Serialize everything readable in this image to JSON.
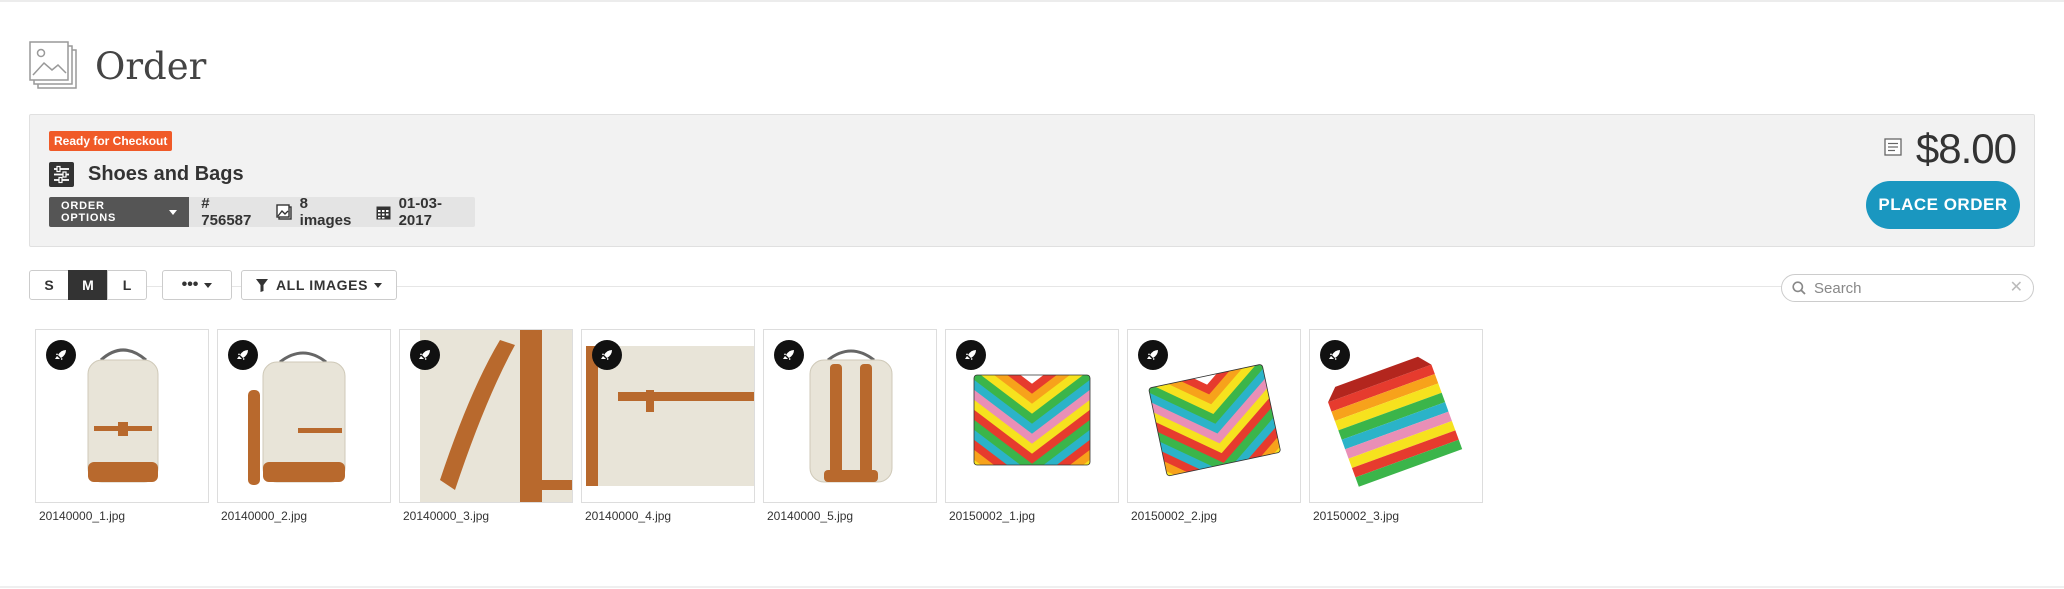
{
  "page": {
    "title": "Order"
  },
  "order": {
    "status": "Ready for Checkout",
    "name": "Shoes and Bags",
    "options_label": "ORDER OPTIONS",
    "number": "# 756587",
    "image_count": "8 images",
    "date": "01-03-2017",
    "price": "$8.00",
    "place_order_label": "PLACE ORDER"
  },
  "toolbar": {
    "sizes": [
      "S",
      "M",
      "L"
    ],
    "active_size": "M",
    "more_label": "•••",
    "filter_label": "ALL IMAGES",
    "search_placeholder": "Search"
  },
  "images": [
    {
      "filename": "20140000_1.jpg",
      "kind": "backpack-front"
    },
    {
      "filename": "20140000_2.jpg",
      "kind": "backpack-angle"
    },
    {
      "filename": "20140000_3.jpg",
      "kind": "backpack-side"
    },
    {
      "filename": "20140000_4.jpg",
      "kind": "backpack-detail"
    },
    {
      "filename": "20140000_5.jpg",
      "kind": "backpack-back"
    },
    {
      "filename": "20150002_1.jpg",
      "kind": "clutch-front"
    },
    {
      "filename": "20150002_2.jpg",
      "kind": "clutch-angle"
    },
    {
      "filename": "20150002_3.jpg",
      "kind": "clutch-open"
    }
  ],
  "colors": {
    "badge": "#f05a28",
    "accent": "#1a97c0",
    "panel": "#f2f2f2",
    "strap": "#b8692d",
    "canvas": "#e8e4d8"
  }
}
